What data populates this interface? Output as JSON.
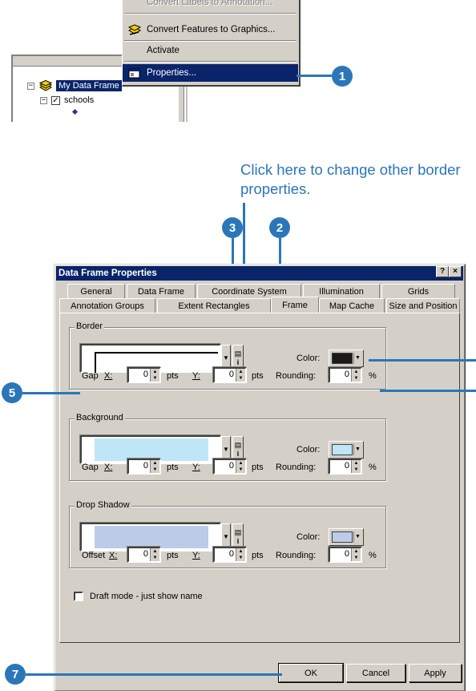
{
  "context_menu": {
    "items": [
      {
        "label": "Convert Labels to Annotation...",
        "icon": "convert-labels-icon",
        "disabled": true
      },
      {
        "label": "Convert Features to Graphics...",
        "icon": "convert-features-icon",
        "accel": "F"
      },
      {
        "label": "Activate",
        "icon": null,
        "accel": "A"
      },
      {
        "label": "Properties...",
        "icon": "properties-icon",
        "highlighted": true
      }
    ]
  },
  "toc": {
    "data_frame": "My Data Frame",
    "layer": "schools"
  },
  "caption": "Click here to change other border properties.",
  "callouts": [
    "1",
    "2",
    "3",
    "5",
    "7"
  ],
  "dialog": {
    "title": "Data Frame Properties",
    "help_btn": "?",
    "close_btn": "×",
    "tabs_row1": [
      "General",
      "Data Frame",
      "Coordinate System",
      "Illumination",
      "Grids"
    ],
    "tabs_row2": [
      "Annotation Groups",
      "Extent Rectangles",
      "Frame",
      "Map Cache",
      "Size and Position"
    ],
    "active_tab": "Frame",
    "border": {
      "label": "Border",
      "color_label": "Color:",
      "gap_label": "Gap",
      "x_label": "X:",
      "y_label": "Y:",
      "x": "0",
      "y": "0",
      "pts": "pts",
      "rounding_label": "Rounding:",
      "rounding": "0",
      "pct": "%",
      "color": "#1a1a1a"
    },
    "background": {
      "label": "Background",
      "color_label": "Color:",
      "gap_label": "Gap",
      "x_label": "X:",
      "y_label": "Y:",
      "x": "0",
      "y": "0",
      "pts": "pts",
      "rounding_label": "Rounding:",
      "rounding": "0",
      "pct": "%",
      "color": "#bee6f6"
    },
    "shadow": {
      "label": "Drop Shadow",
      "color_label": "Color:",
      "gap_label": "Offset",
      "x_label": "X:",
      "y_label": "Y:",
      "x": "0",
      "y": "0",
      "pts": "pts",
      "rounding_label": "Rounding:",
      "rounding": "0",
      "pct": "%",
      "color": "#bccbe8"
    },
    "draft_mode": "Draft mode - just show name",
    "ok": "OK",
    "cancel": "Cancel",
    "apply": "Apply"
  },
  "colors": {
    "accent": "#2a76b9",
    "title_bar": "#0a246a",
    "face": "#d4d0c8"
  }
}
